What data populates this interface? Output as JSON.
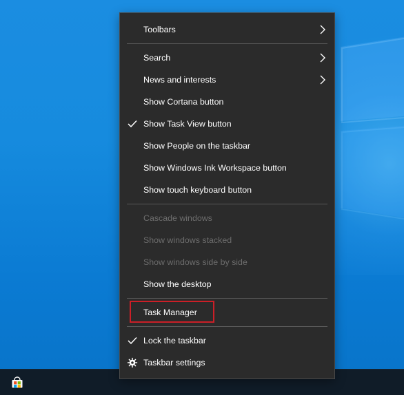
{
  "menu": {
    "items": [
      {
        "id": "toolbars",
        "label": "Toolbars"
      },
      {
        "id": "search",
        "label": "Search"
      },
      {
        "id": "news",
        "label": "News and interests"
      },
      {
        "id": "cortana",
        "label": "Show Cortana button"
      },
      {
        "id": "taskview",
        "label": "Show Task View button"
      },
      {
        "id": "people",
        "label": "Show People on the taskbar"
      },
      {
        "id": "ink",
        "label": "Show Windows Ink Workspace button"
      },
      {
        "id": "touchkb",
        "label": "Show touch keyboard button"
      },
      {
        "id": "cascade",
        "label": "Cascade windows"
      },
      {
        "id": "stacked",
        "label": "Show windows stacked"
      },
      {
        "id": "sidebyside",
        "label": "Show windows side by side"
      },
      {
        "id": "desktop",
        "label": "Show the desktop"
      },
      {
        "id": "taskmanager",
        "label": "Task Manager"
      },
      {
        "id": "lock",
        "label": "Lock the taskbar"
      },
      {
        "id": "settings",
        "label": "Taskbar settings"
      }
    ]
  },
  "colors": {
    "menu_bg": "#2b2b2b",
    "menu_text": "#ffffff",
    "disabled_text": "#6d6d6d",
    "separator": "#5a5a5a",
    "highlight": "#cc1f27",
    "taskbar": "#101c28",
    "desktop_blue": "#168bde"
  },
  "icons": {
    "checkmark": "check-icon",
    "submenu": "chevron-right-icon",
    "settings": "gear-icon",
    "store": "microsoft-store-icon",
    "wallpaper": "windows-logo-icon"
  }
}
